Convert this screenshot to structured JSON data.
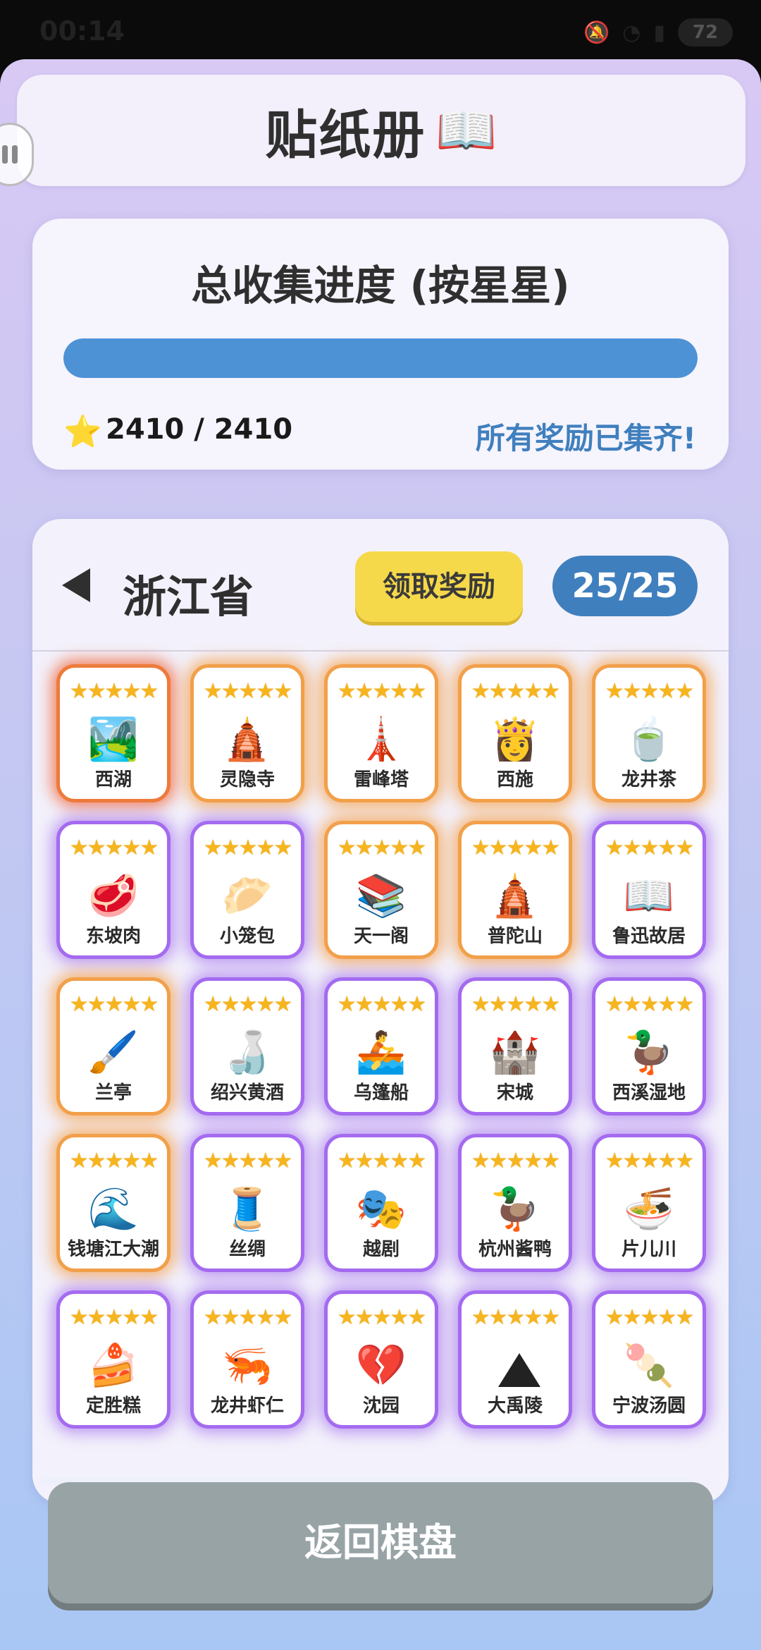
{
  "status_bar": {
    "time": "00:14",
    "battery": "72"
  },
  "header": {
    "title": "贴纸册",
    "title_icon": "📖"
  },
  "progress": {
    "title": "总收集进度 (按星星)",
    "count": "2410 / 2410",
    "status": "所有奖励已集齐!",
    "fraction": 1.0,
    "star_icon": "⭐"
  },
  "album": {
    "province": "浙江省",
    "claim_label": "领取奖励",
    "count": "25/25",
    "star_string": "★★★★★",
    "stickers": [
      {
        "label": "西湖",
        "icon": "🏞️",
        "glow": "red"
      },
      {
        "label": "灵隐寺",
        "icon": "🛕",
        "glow": "orange"
      },
      {
        "label": "雷峰塔",
        "icon": "🗼",
        "glow": "orange"
      },
      {
        "label": "西施",
        "icon": "👸",
        "glow": "orange"
      },
      {
        "label": "龙井茶",
        "icon": "🍵",
        "glow": "orange"
      },
      {
        "label": "东坡肉",
        "icon": "🥩",
        "glow": "purple"
      },
      {
        "label": "小笼包",
        "icon": "🥟",
        "glow": "purple"
      },
      {
        "label": "天一阁",
        "icon": "📚",
        "glow": "orange"
      },
      {
        "label": "普陀山",
        "icon": "🛕",
        "glow": "orange"
      },
      {
        "label": "鲁迅故居",
        "icon": "📖",
        "glow": "purple"
      },
      {
        "label": "兰亭",
        "icon": "🖌️",
        "glow": "orange"
      },
      {
        "label": "绍兴黄酒",
        "icon": "🍶",
        "glow": "purple"
      },
      {
        "label": "乌篷船",
        "icon": "🚣",
        "glow": "purple"
      },
      {
        "label": "宋城",
        "icon": "🏰",
        "glow": "purple"
      },
      {
        "label": "西溪湿地",
        "icon": "🦆",
        "glow": "purple"
      },
      {
        "label": "钱塘江大潮",
        "icon": "🌊",
        "glow": "orange"
      },
      {
        "label": "丝绸",
        "icon": "🧵",
        "glow": "purple"
      },
      {
        "label": "越剧",
        "icon": "🎭",
        "glow": "purple"
      },
      {
        "label": "杭州酱鸭",
        "icon": "🦆",
        "glow": "purple"
      },
      {
        "label": "片儿川",
        "icon": "🍜",
        "glow": "purple"
      },
      {
        "label": "定胜糕",
        "icon": "🍰",
        "glow": "purple"
      },
      {
        "label": "龙井虾仁",
        "icon": "🦐",
        "glow": "purple"
      },
      {
        "label": "沈园",
        "icon": "💔",
        "glow": "purple"
      },
      {
        "label": "大禹陵",
        "icon": "triangle",
        "glow": "purple"
      },
      {
        "label": "宁波汤圆",
        "icon": "🍡",
        "glow": "purple"
      }
    ]
  },
  "footer": {
    "return_label": "返回棋盘"
  }
}
